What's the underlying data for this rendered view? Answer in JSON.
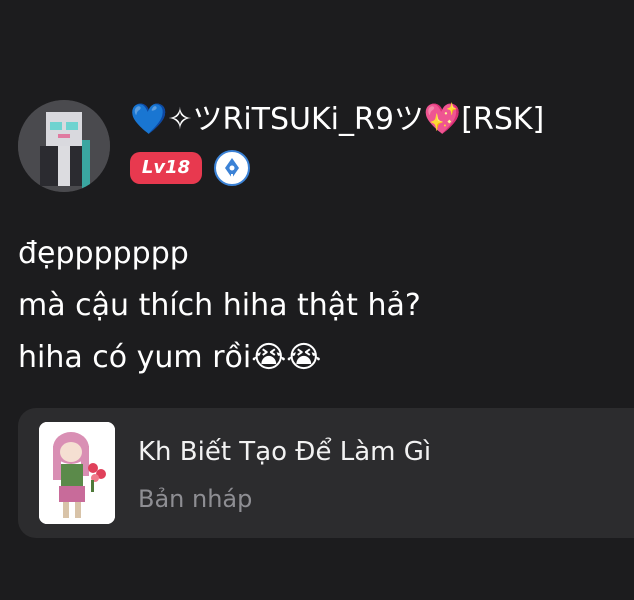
{
  "post": {
    "username": "💙✧ツRiTSUKi_R9ツ💖[RSK]",
    "level_label": "Lv18",
    "comment_lines": [
      "đẹppppppp",
      "mà cậu thích hiha thật hả?",
      "hiha có yum rồi😭😭"
    ]
  },
  "draft_card": {
    "title": "Kh Biết Tạo Để Làm Gì",
    "subtitle": "Bản nháp"
  },
  "icons": {
    "avatar": "user-avatar",
    "title_badge": "pen-nib-icon",
    "thumbnail": "draft-thumbnail"
  },
  "colors": {
    "background": "#1c1c1e",
    "card": "#2c2c2e",
    "level_badge": "#e8394f",
    "title_badge_border": "#3b82d6",
    "muted_text": "#8e8e93"
  }
}
